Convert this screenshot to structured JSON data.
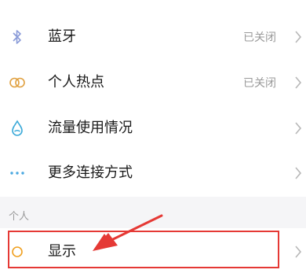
{
  "settings": {
    "rows": [
      {
        "label": "蓝牙",
        "value": "已关闭",
        "icon": "bluetooth-icon"
      },
      {
        "label": "个人热点",
        "value": "已关闭",
        "icon": "hotspot-icon"
      },
      {
        "label": "流量使用情况",
        "value": "",
        "icon": "data-usage-icon"
      },
      {
        "label": "更多连接方式",
        "value": "",
        "icon": "more-icon"
      }
    ],
    "section_personal": "个人",
    "display_label": "显示"
  },
  "colors": {
    "bluetooth": "#7b8fd6",
    "hotspot": "#e0a040",
    "data_usage": "#3aa9d8",
    "more": "#4aa8e0",
    "display": "#f0a020",
    "annotation": "#e53935"
  }
}
